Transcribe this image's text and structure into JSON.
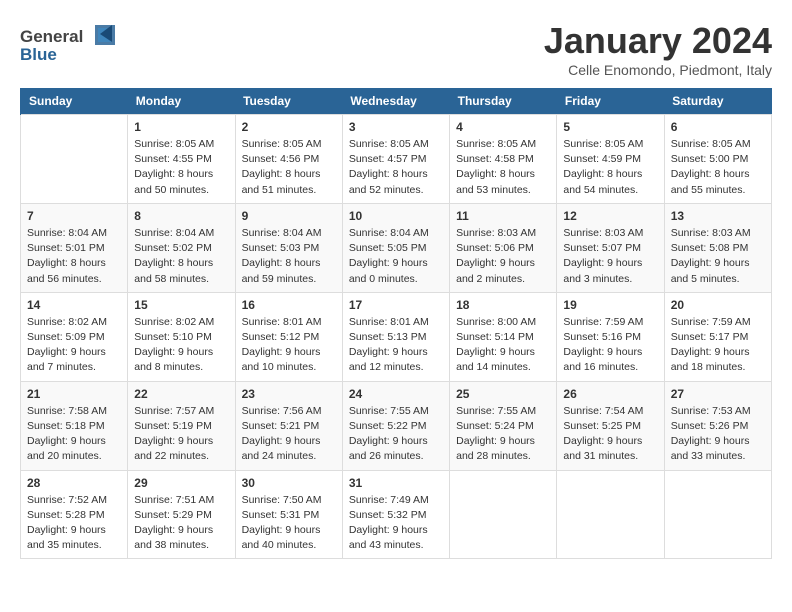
{
  "header": {
    "logo_general": "General",
    "logo_blue": "Blue",
    "month_title": "January 2024",
    "location": "Celle Enomondo, Piedmont, Italy"
  },
  "days_of_week": [
    "Sunday",
    "Monday",
    "Tuesday",
    "Wednesday",
    "Thursday",
    "Friday",
    "Saturday"
  ],
  "weeks": [
    [
      {
        "day": "",
        "info": ""
      },
      {
        "day": "1",
        "info": "Sunrise: 8:05 AM\nSunset: 4:55 PM\nDaylight: 8 hours\nand 50 minutes."
      },
      {
        "day": "2",
        "info": "Sunrise: 8:05 AM\nSunset: 4:56 PM\nDaylight: 8 hours\nand 51 minutes."
      },
      {
        "day": "3",
        "info": "Sunrise: 8:05 AM\nSunset: 4:57 PM\nDaylight: 8 hours\nand 52 minutes."
      },
      {
        "day": "4",
        "info": "Sunrise: 8:05 AM\nSunset: 4:58 PM\nDaylight: 8 hours\nand 53 minutes."
      },
      {
        "day": "5",
        "info": "Sunrise: 8:05 AM\nSunset: 4:59 PM\nDaylight: 8 hours\nand 54 minutes."
      },
      {
        "day": "6",
        "info": "Sunrise: 8:05 AM\nSunset: 5:00 PM\nDaylight: 8 hours\nand 55 minutes."
      }
    ],
    [
      {
        "day": "7",
        "info": "Sunrise: 8:04 AM\nSunset: 5:01 PM\nDaylight: 8 hours\nand 56 minutes."
      },
      {
        "day": "8",
        "info": "Sunrise: 8:04 AM\nSunset: 5:02 PM\nDaylight: 8 hours\nand 58 minutes."
      },
      {
        "day": "9",
        "info": "Sunrise: 8:04 AM\nSunset: 5:03 PM\nDaylight: 8 hours\nand 59 minutes."
      },
      {
        "day": "10",
        "info": "Sunrise: 8:04 AM\nSunset: 5:05 PM\nDaylight: 9 hours\nand 0 minutes."
      },
      {
        "day": "11",
        "info": "Sunrise: 8:03 AM\nSunset: 5:06 PM\nDaylight: 9 hours\nand 2 minutes."
      },
      {
        "day": "12",
        "info": "Sunrise: 8:03 AM\nSunset: 5:07 PM\nDaylight: 9 hours\nand 3 minutes."
      },
      {
        "day": "13",
        "info": "Sunrise: 8:03 AM\nSunset: 5:08 PM\nDaylight: 9 hours\nand 5 minutes."
      }
    ],
    [
      {
        "day": "14",
        "info": "Sunrise: 8:02 AM\nSunset: 5:09 PM\nDaylight: 9 hours\nand 7 minutes."
      },
      {
        "day": "15",
        "info": "Sunrise: 8:02 AM\nSunset: 5:10 PM\nDaylight: 9 hours\nand 8 minutes."
      },
      {
        "day": "16",
        "info": "Sunrise: 8:01 AM\nSunset: 5:12 PM\nDaylight: 9 hours\nand 10 minutes."
      },
      {
        "day": "17",
        "info": "Sunrise: 8:01 AM\nSunset: 5:13 PM\nDaylight: 9 hours\nand 12 minutes."
      },
      {
        "day": "18",
        "info": "Sunrise: 8:00 AM\nSunset: 5:14 PM\nDaylight: 9 hours\nand 14 minutes."
      },
      {
        "day": "19",
        "info": "Sunrise: 7:59 AM\nSunset: 5:16 PM\nDaylight: 9 hours\nand 16 minutes."
      },
      {
        "day": "20",
        "info": "Sunrise: 7:59 AM\nSunset: 5:17 PM\nDaylight: 9 hours\nand 18 minutes."
      }
    ],
    [
      {
        "day": "21",
        "info": "Sunrise: 7:58 AM\nSunset: 5:18 PM\nDaylight: 9 hours\nand 20 minutes."
      },
      {
        "day": "22",
        "info": "Sunrise: 7:57 AM\nSunset: 5:19 PM\nDaylight: 9 hours\nand 22 minutes."
      },
      {
        "day": "23",
        "info": "Sunrise: 7:56 AM\nSunset: 5:21 PM\nDaylight: 9 hours\nand 24 minutes."
      },
      {
        "day": "24",
        "info": "Sunrise: 7:55 AM\nSunset: 5:22 PM\nDaylight: 9 hours\nand 26 minutes."
      },
      {
        "day": "25",
        "info": "Sunrise: 7:55 AM\nSunset: 5:24 PM\nDaylight: 9 hours\nand 28 minutes."
      },
      {
        "day": "26",
        "info": "Sunrise: 7:54 AM\nSunset: 5:25 PM\nDaylight: 9 hours\nand 31 minutes."
      },
      {
        "day": "27",
        "info": "Sunrise: 7:53 AM\nSunset: 5:26 PM\nDaylight: 9 hours\nand 33 minutes."
      }
    ],
    [
      {
        "day": "28",
        "info": "Sunrise: 7:52 AM\nSunset: 5:28 PM\nDaylight: 9 hours\nand 35 minutes."
      },
      {
        "day": "29",
        "info": "Sunrise: 7:51 AM\nSunset: 5:29 PM\nDaylight: 9 hours\nand 38 minutes."
      },
      {
        "day": "30",
        "info": "Sunrise: 7:50 AM\nSunset: 5:31 PM\nDaylight: 9 hours\nand 40 minutes."
      },
      {
        "day": "31",
        "info": "Sunrise: 7:49 AM\nSunset: 5:32 PM\nDaylight: 9 hours\nand 43 minutes."
      },
      {
        "day": "",
        "info": ""
      },
      {
        "day": "",
        "info": ""
      },
      {
        "day": "",
        "info": ""
      }
    ]
  ]
}
